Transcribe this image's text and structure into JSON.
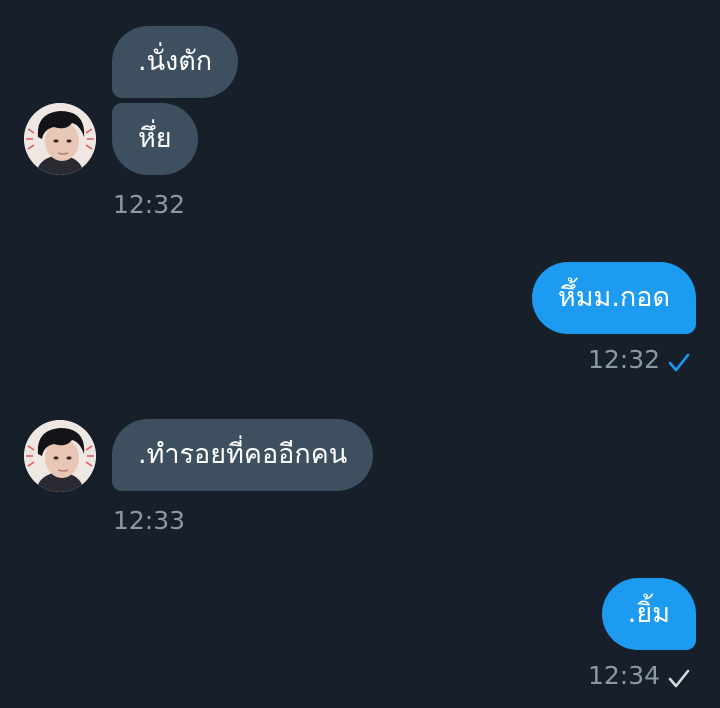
{
  "conversation": {
    "messages": [
      {
        "direction": "incoming",
        "text": ".นั่งตัก"
      },
      {
        "direction": "incoming",
        "text": "หึ่ย",
        "time": "12:32"
      },
      {
        "direction": "outgoing",
        "text": "หึ้มม.กอด",
        "time": "12:32",
        "status": "sent-icon"
      },
      {
        "direction": "incoming",
        "text": ".ทำรอยที่คออีกคน",
        "time": "12:33"
      },
      {
        "direction": "outgoing",
        "text": ".ยิ้ม",
        "time": "12:34",
        "status": "seen-icon"
      }
    ]
  },
  "colors": {
    "background": "#17202a",
    "incoming_bubble": "#3e4f5f",
    "outgoing_bubble": "#1d9bf0",
    "timestamp": "#8b98a5",
    "check_blue": "#1d9bf0",
    "check_gray": "#d7dbdf"
  }
}
